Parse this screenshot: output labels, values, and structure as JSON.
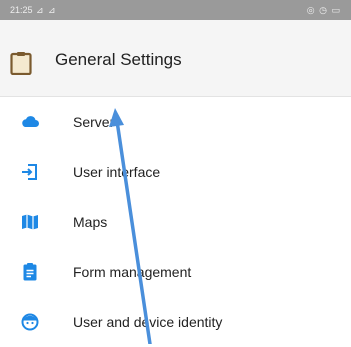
{
  "status_bar": {
    "time": "21:25",
    "signal": "⊿ ⊿",
    "right_icons": "◎ ◷ ▭"
  },
  "app_bar": {
    "title": "General Settings",
    "icon": "clipboard-icon"
  },
  "menu": {
    "items": [
      {
        "label": "Server",
        "icon": "cloud-icon"
      },
      {
        "label": "User interface",
        "icon": "login-icon"
      },
      {
        "label": "Maps",
        "icon": "map-icon"
      },
      {
        "label": "Form management",
        "icon": "form-list-icon"
      },
      {
        "label": "User and device identity",
        "icon": "face-icon"
      }
    ]
  },
  "colors": {
    "accent_blue": "#1a73e8",
    "icon_blue": "#1e88e5",
    "app_bar_bg": "#f5f5f5",
    "status_bar_bg": "#9a9a9a",
    "clipboard_brown": "#7a5a2e",
    "arrow_blue": "#4a8fdb"
  }
}
